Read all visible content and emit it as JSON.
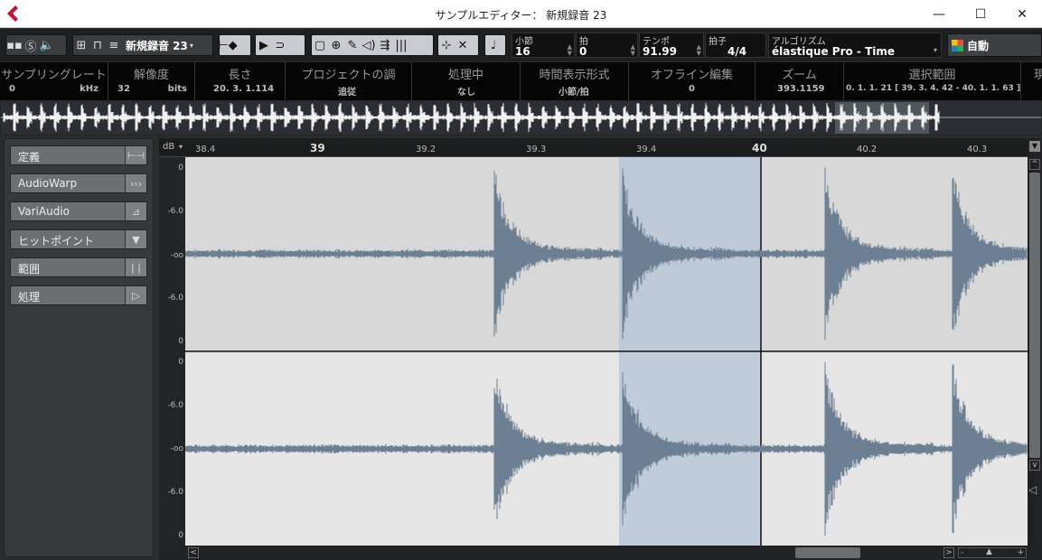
{
  "window": {
    "title": "サンプルエディター： 新規録音 23",
    "minimize": "—",
    "maximize": "☐",
    "close": "✕"
  },
  "toolbar": {
    "event_name": "新規録音 23",
    "fields": [
      {
        "label": "小節",
        "value": "16"
      },
      {
        "label": "拍",
        "value": "0"
      },
      {
        "label": "テンポ",
        "value": "91.99"
      },
      {
        "label": "拍子",
        "value": "4/4"
      },
      {
        "label": "アルゴリズム",
        "value": "élastique Pro - Time"
      }
    ],
    "auto_label": "自動"
  },
  "info_line": [
    {
      "header": "サンプリングレート",
      "value": "0",
      "unit": "kHz"
    },
    {
      "header": "解像度",
      "value": "32",
      "unit": "bits"
    },
    {
      "header": "長さ",
      "value": "20. 3. 1.114"
    },
    {
      "header": "プロジェクトの調",
      "value": "追従"
    },
    {
      "header": "処理中",
      "value": "なし"
    },
    {
      "header": "時間表示形式",
      "value": "小節/拍"
    },
    {
      "header": "オフライン編集",
      "value": "0"
    },
    {
      "header": "ズーム",
      "value": "393.1159"
    },
    {
      "header": "選択範囲",
      "value": "0. 1. 1. 21 [ 39. 3. 4. 42 - 40. 1. 1. 63 ]"
    },
    {
      "header": "現"
    }
  ],
  "sidebar": {
    "items": [
      {
        "label": "定義",
        "icon": "define-icon"
      },
      {
        "label": "AudioWarp",
        "icon": "warp-icon"
      },
      {
        "label": "VariAudio",
        "icon": "variaudio-icon"
      },
      {
        "label": "ヒットポイント",
        "icon": "hitpoint-icon"
      },
      {
        "label": "範囲",
        "icon": "range-icon"
      },
      {
        "label": "処理",
        "icon": "process-icon"
      }
    ]
  },
  "ruler": {
    "unit_label": "dB",
    "labels": [
      "38.4",
      "39",
      "39.2",
      "39.3",
      "39.4",
      "40",
      "40.2",
      "40.3"
    ]
  },
  "db_scale": [
    "0",
    "-6.0",
    "-oo",
    "-6.0",
    "0"
  ],
  "colors": {
    "accent": "#c0143c",
    "selection": "#b9c7d6",
    "waveform": "#6d7f93",
    "waveform_bg": "#e3e3e3"
  }
}
